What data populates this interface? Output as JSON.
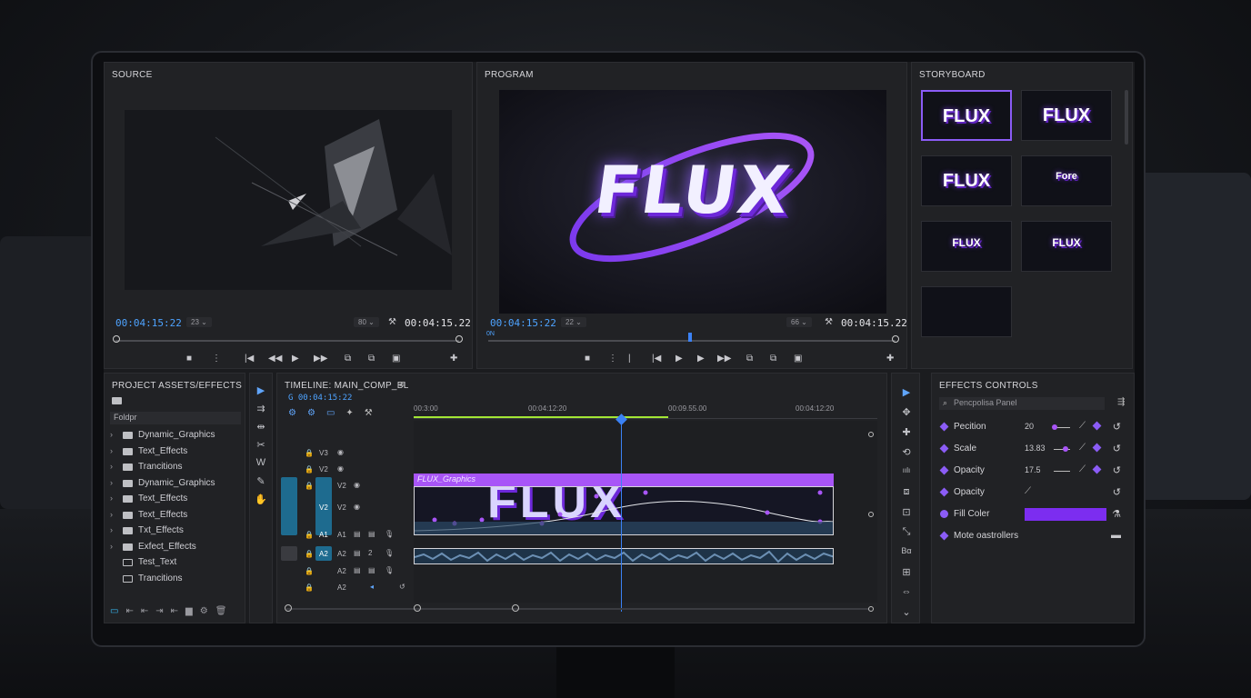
{
  "source": {
    "title": "SOURCE",
    "timecode_in": "00:04:15:22",
    "zoom": "23",
    "quality": "80",
    "timecode_out": "00:04:15.22"
  },
  "program": {
    "title": "PROGRAM",
    "logo_text": "FLUX",
    "timecode_in": "00:04:15:22",
    "zoom": "22",
    "quality": "66",
    "timecode_out": "00:04:15.22",
    "scrub_label": "0N"
  },
  "storyboard": {
    "title": "STORYBOARD",
    "thumbs": [
      "FLUX",
      "FLUX",
      "FLUX",
      "Fore",
      "FLUX",
      "FLUX",
      ""
    ]
  },
  "project": {
    "title": "PROJECT ASSETS/EFFECTS",
    "folder_label": "Foldpr",
    "items": [
      {
        "label": "Dynamic_Graphics",
        "type": "folder"
      },
      {
        "label": "Text_Effects",
        "type": "folder"
      },
      {
        "label": "Trancitions",
        "type": "folder"
      },
      {
        "label": "Dynamic_Graphics",
        "type": "folder"
      },
      {
        "label": "Text_Effects",
        "type": "folder"
      },
      {
        "label": "Text_Effects",
        "type": "folder"
      },
      {
        "label": "Txt_Effects",
        "type": "folder"
      },
      {
        "label": "Exfect_Effects",
        "type": "folder"
      },
      {
        "label": "Test_Text",
        "type": "file"
      },
      {
        "label": "Trancitions",
        "type": "file"
      }
    ]
  },
  "timeline": {
    "title": "TIMELINE: MAIN_COMP_BL",
    "timecode": "G 00:04:15:22",
    "ruler": [
      "00:3:00",
      "00:04:12:20",
      "00:09.55.00",
      "00:04:12:20"
    ],
    "tracks": [
      {
        "name": "V3",
        "label": "V3"
      },
      {
        "name": "V2",
        "label": "V2"
      },
      {
        "name": "V2",
        "label": "V2"
      },
      {
        "name": "A1",
        "label": "A1"
      },
      {
        "name": "A2",
        "label": "A2"
      },
      {
        "name": "A2",
        "label": "A2"
      },
      {
        "name": "A2",
        "label": "A2"
      }
    ],
    "clip_label": "FLUX_Graphics",
    "clip_text": "FLUX"
  },
  "effects": {
    "title": "EFFECTS CONTROLS",
    "search_placeholder": "Pencpolisa Panel",
    "rows": [
      {
        "name": "Pecition",
        "value": "20"
      },
      {
        "name": "Scale",
        "value": "13.83"
      },
      {
        "name": "Opacity",
        "value": "17.5"
      },
      {
        "name": "Opacity",
        "value": ""
      },
      {
        "name": "Fill Coler",
        "value": ""
      },
      {
        "name": "Mote oastrollers",
        "value": ""
      }
    ],
    "fill_color": "#7c2df0"
  },
  "colors": {
    "accent": "#8b5cf6",
    "timecode_blue": "#4ea3ff",
    "playhead": "#3b82f6"
  }
}
